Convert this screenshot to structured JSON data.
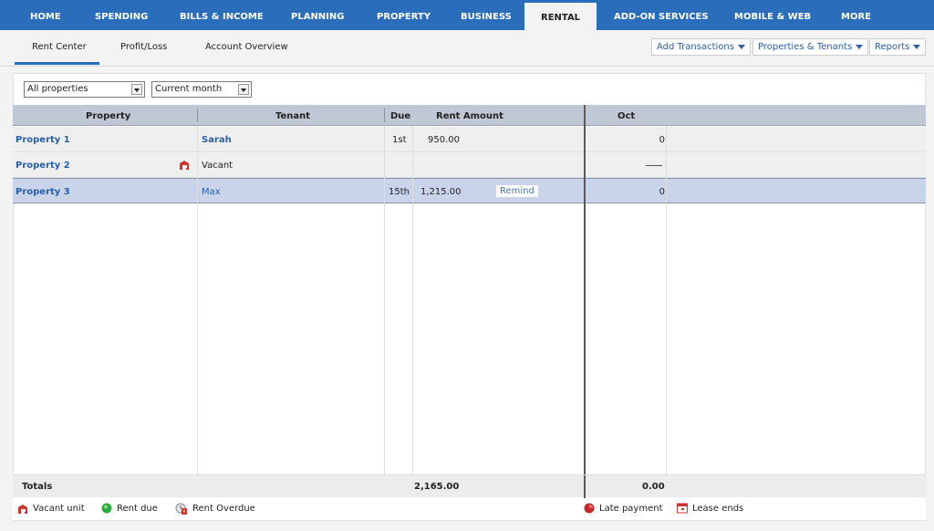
{
  "topnav": {
    "items": [
      "HOME",
      "SPENDING",
      "BILLS & INCOME",
      "PLANNING",
      "PROPERTY",
      "BUSINESS",
      "RENTAL",
      "ADD-ON SERVICES",
      "MOBILE & WEB",
      "MORE"
    ],
    "active": "RENTAL"
  },
  "subnav": {
    "tabs": [
      "Rent Center",
      "Profit/Loss",
      "Account Overview"
    ],
    "active": "Rent Center",
    "buttons": [
      "Add Transactions",
      "Properties & Tenants",
      "Reports"
    ]
  },
  "filters": {
    "property": "All properties",
    "period": "Current month"
  },
  "table": {
    "columns": [
      "Property",
      "Tenant",
      "Due",
      "Rent Amount",
      "Oct"
    ],
    "rows": [
      {
        "property": "Property 1",
        "tenant": "Sarah",
        "due": "1st",
        "rent": "950.00",
        "oct": "0",
        "vacant": false
      },
      {
        "property": "Property 2",
        "tenant": "Vacant",
        "due": "",
        "rent": "",
        "oct": "—",
        "vacant": true
      },
      {
        "property": "Property 3",
        "tenant": "Max",
        "due": "15th",
        "rent": "1,215.00",
        "oct": "0",
        "vacant": false,
        "action": "Remind",
        "selected": true
      }
    ],
    "totals": {
      "label": "Totals",
      "rent": "2,165.00",
      "oct": "0.00"
    }
  },
  "legend": {
    "vacant_unit": "Vacant unit",
    "rent_due": "Rent due",
    "rent_overdue": "Rent Overdue",
    "late_payment": "Late payment",
    "lease_ends": "Lease ends"
  },
  "colors": {
    "nav_blue": "#2a6ebb",
    "link_blue": "#2a5fa8",
    "selected_row": "#c9d3ea",
    "vacant_red": "#d0342c",
    "rent_due_green": "#2eaa3a"
  }
}
